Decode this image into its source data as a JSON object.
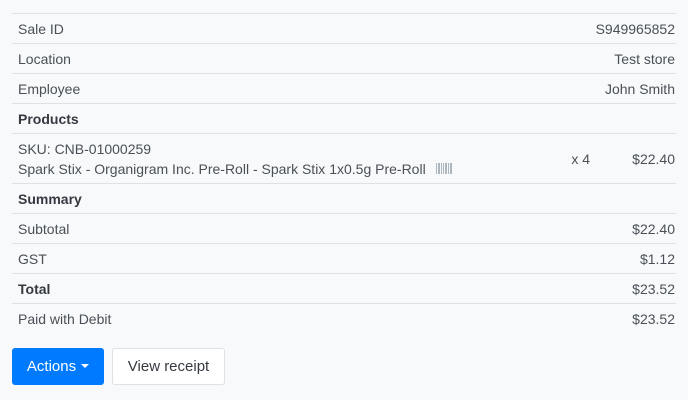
{
  "sale": {
    "id_label": "Sale ID",
    "id_value": "S949965852",
    "location_label": "Location",
    "location_value": "Test store",
    "employee_label": "Employee",
    "employee_value": "John Smith"
  },
  "products": {
    "heading": "Products",
    "items": [
      {
        "sku": "SKU: CNB-01000259",
        "name": "Spark Stix - Organigram Inc. Pre-Roll - Spark Stix 1x0.5g Pre-Roll",
        "icon": "barcode-icon",
        "quantity": "x 4",
        "price": "$22.40"
      }
    ]
  },
  "summary": {
    "heading": "Summary",
    "subtotal_label": "Subtotal",
    "subtotal_value": "$22.40",
    "tax_label": "GST",
    "tax_value": "$1.12",
    "total_label": "Total",
    "total_value": "$23.52",
    "payment_label": "Paid with Debit",
    "payment_value": "$23.52"
  },
  "actions": {
    "actions_label": "Actions",
    "view_receipt_label": "View receipt"
  },
  "colors": {
    "primary": "#007bff",
    "border": "#dee2e6",
    "background": "#f8f9fa",
    "text": "#495057"
  }
}
